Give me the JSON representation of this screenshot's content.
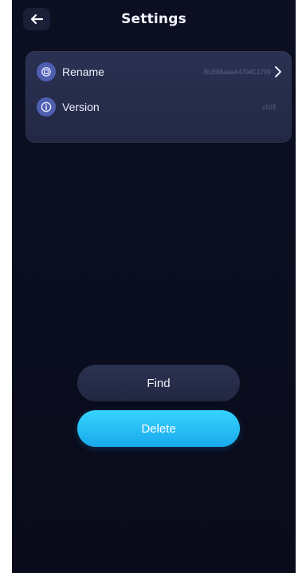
{
  "header": {
    "title": "Settings",
    "back_icon": "arrow-left-icon"
  },
  "settings": {
    "rows": [
      {
        "label": "Rename",
        "value": "BLE88aaaA4704C1709",
        "icon": "rename-icon",
        "trailing_icon": "chevron-right-icon"
      },
      {
        "label": "Version",
        "value": "v103",
        "icon": "info-icon"
      }
    ]
  },
  "actions": {
    "find_label": "Find",
    "delete_label": "Delete"
  },
  "colors": {
    "background": "#0b0e20",
    "card": "#262c4a",
    "accent": "#24bdf5",
    "icon_bg": "#4f5fb0"
  }
}
